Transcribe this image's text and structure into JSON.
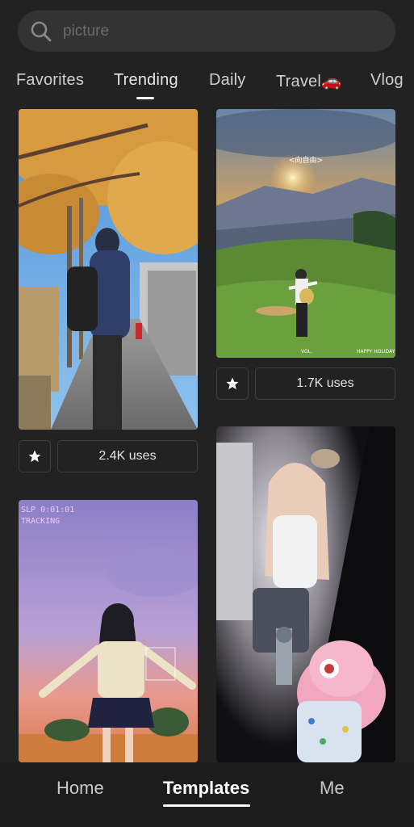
{
  "search": {
    "placeholder": "picture"
  },
  "tabs": [
    {
      "label": "Favorites",
      "active": false
    },
    {
      "label": "Trending",
      "active": true
    },
    {
      "label": "Daily",
      "active": false
    },
    {
      "label": "Travel🚗",
      "active": false
    },
    {
      "label": "Vlog",
      "active": false
    }
  ],
  "templates": [
    {
      "uses_label": "2.4K uses"
    },
    {
      "uses_label": "1.7K uses",
      "overlay_title": "<向自由>",
      "overlay_left": "VOL.",
      "overlay_right": "HAPPY HOLIDAY"
    },
    {
      "overlay_line1": "SLP 0:01:01",
      "overlay_line2": "TRACKING"
    },
    {}
  ],
  "bottom_nav": [
    {
      "label": "Home",
      "active": false
    },
    {
      "label": "Templates",
      "active": true
    },
    {
      "label": "Me",
      "active": false
    }
  ],
  "colors": {
    "background": "#222222",
    "surface": "#333333",
    "accent": "#ffffff"
  },
  "icons": {
    "search": "search-icon",
    "favorite": "star-icon"
  }
}
